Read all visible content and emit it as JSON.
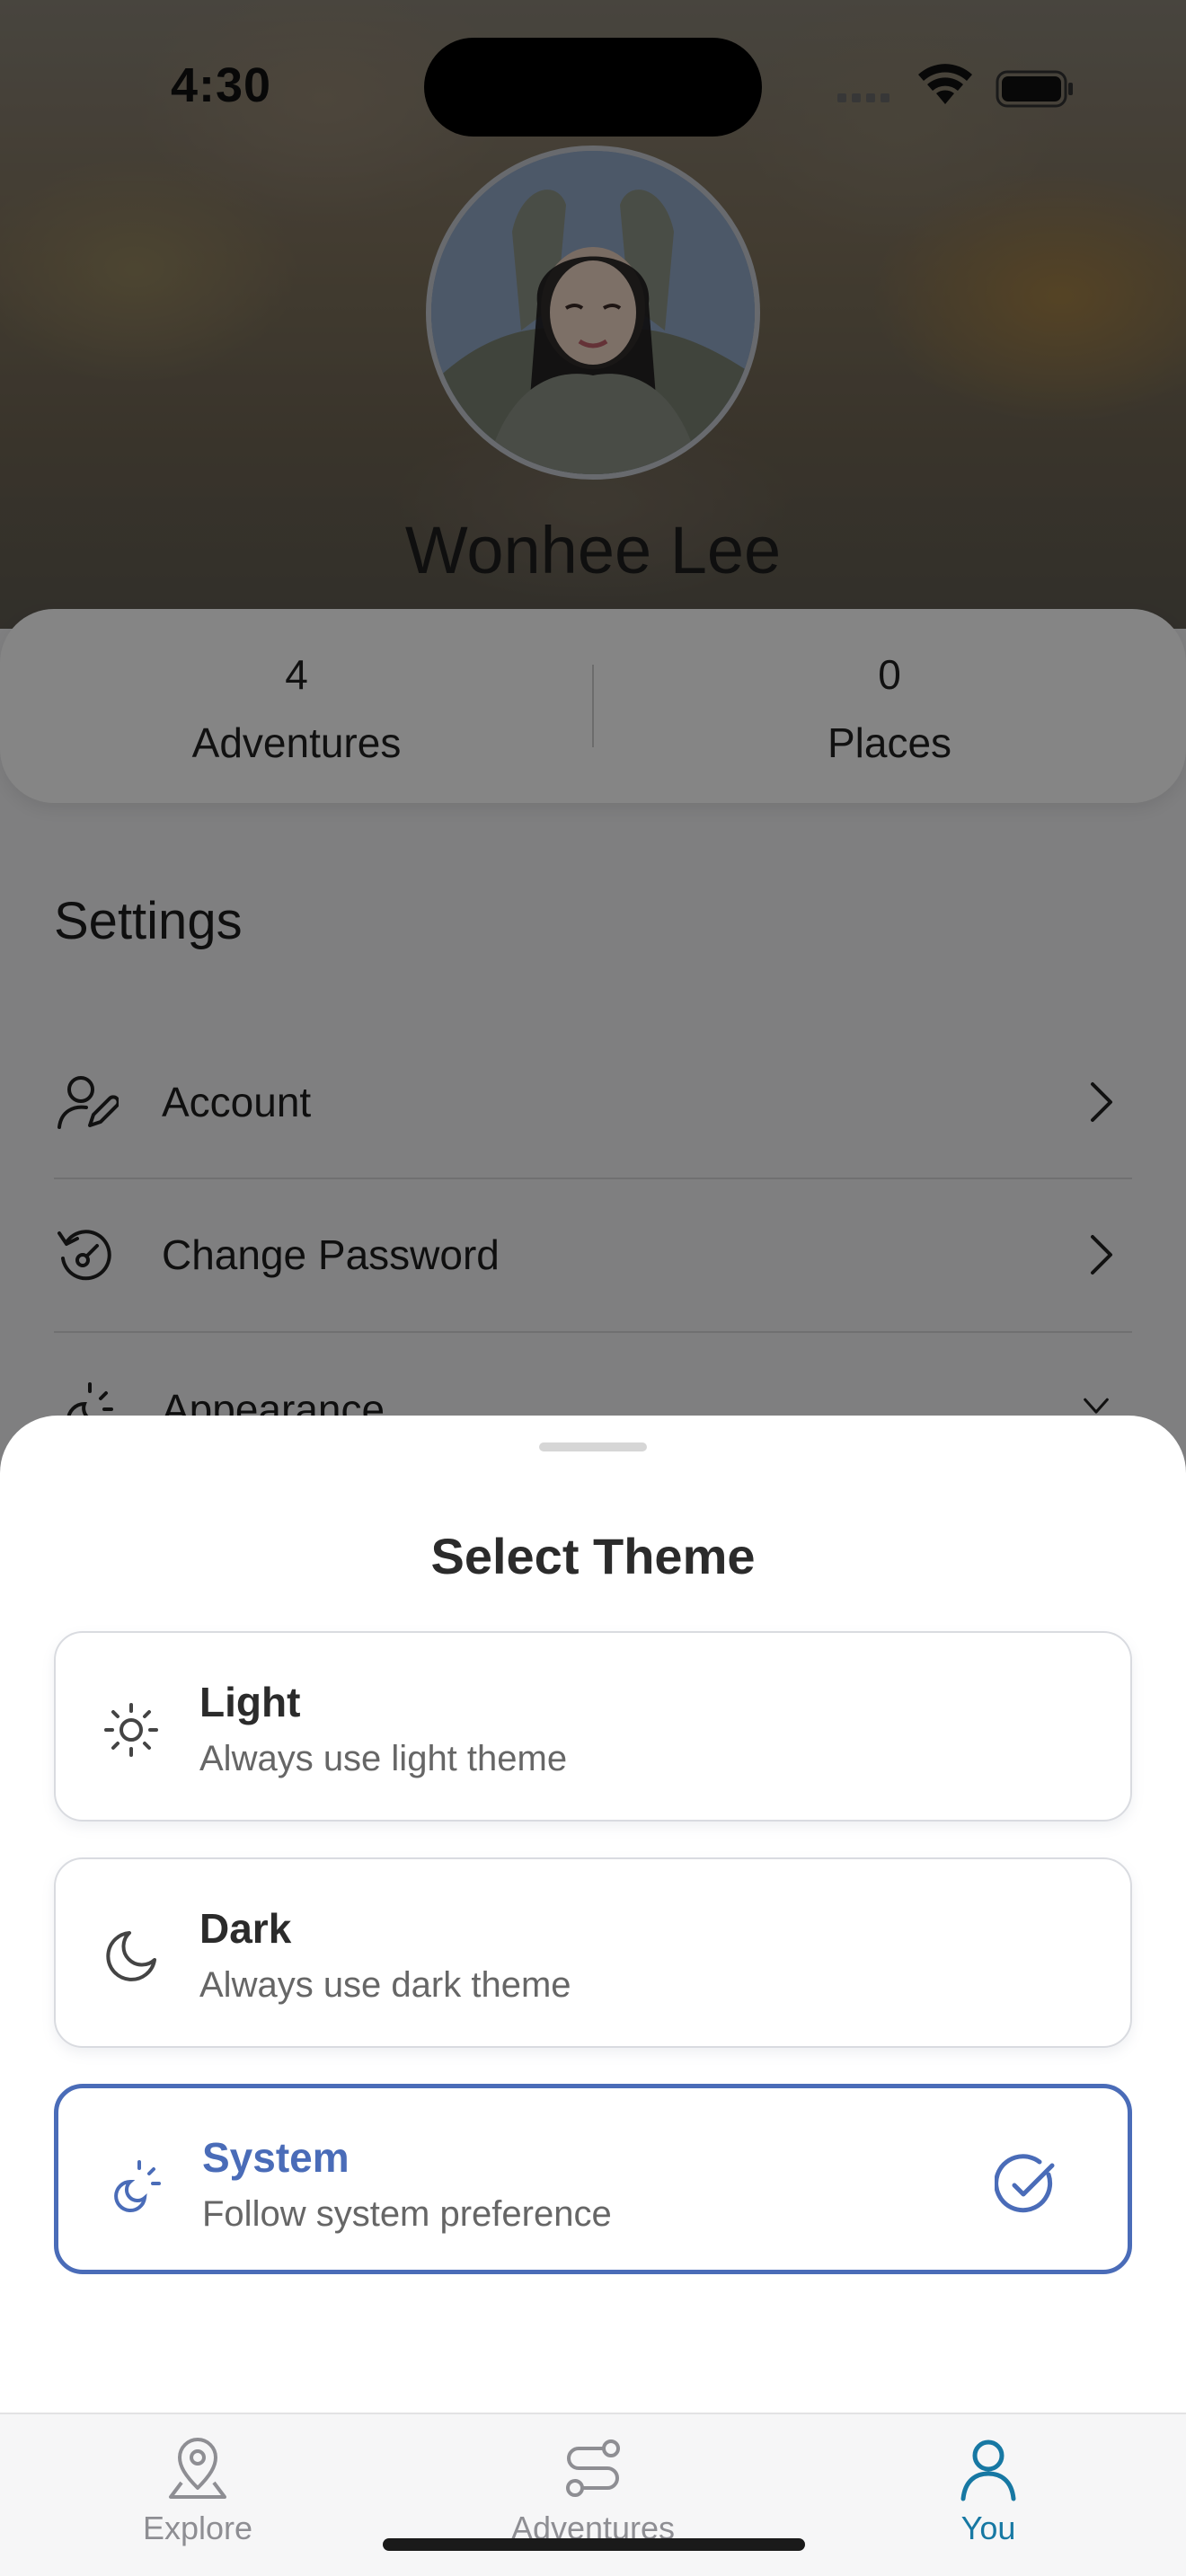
{
  "status_bar": {
    "time": "4:30"
  },
  "profile": {
    "name": "Wonhee Lee"
  },
  "stats": [
    {
      "value": "4",
      "label": "Adventures"
    },
    {
      "value": "0",
      "label": "Places"
    }
  ],
  "settings": {
    "title": "Settings",
    "items": [
      {
        "label": "Account",
        "icon": "user-edit-icon"
      },
      {
        "label": "Change Password",
        "icon": "password-reset-icon"
      },
      {
        "label": "Appearance",
        "icon": "sun-moon-icon"
      }
    ]
  },
  "theme_sheet": {
    "title": "Select Theme",
    "selected": "System",
    "accent_color": "#4a6cb8",
    "options": [
      {
        "title": "Light",
        "description": "Always use light theme",
        "icon": "sun-icon"
      },
      {
        "title": "Dark",
        "description": "Always use dark theme",
        "icon": "moon-icon"
      },
      {
        "title": "System",
        "description": "Follow system preference",
        "icon": "sun-moon-icon"
      }
    ]
  },
  "tab_bar": {
    "active": "You",
    "active_color": "#1778a3",
    "tabs": [
      {
        "label": "Explore",
        "icon": "map-pin-icon"
      },
      {
        "label": "Adventures",
        "icon": "route-icon"
      },
      {
        "label": "You",
        "icon": "person-icon"
      }
    ]
  }
}
